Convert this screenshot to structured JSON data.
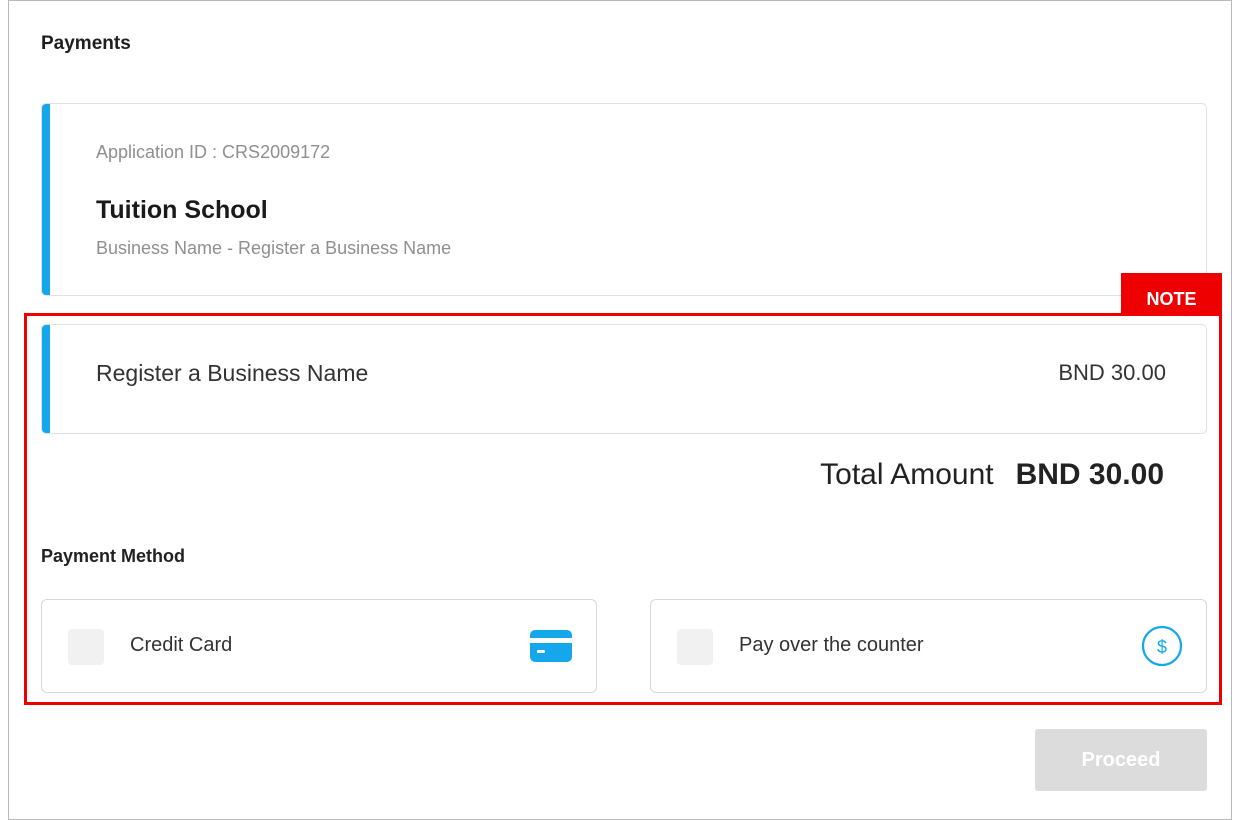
{
  "page": {
    "title": "Payments"
  },
  "application": {
    "id_text": "Application ID : CRS2009172",
    "name": "Tuition School",
    "description": "Business Name - Register a Business Name"
  },
  "note": {
    "tag": "NOTE",
    "color": "#ef0000"
  },
  "fee": {
    "label": "Register a Business Name",
    "amount": "BND 30.00"
  },
  "total": {
    "label": "Total Amount",
    "value": "BND 30.00"
  },
  "payment_method": {
    "heading": "Payment Method",
    "options": [
      {
        "label": "Credit Card",
        "icon": "credit-card-icon",
        "checked": false
      },
      {
        "label": "Pay over the counter",
        "icon": "dollar-circle-icon",
        "checked": false
      }
    ]
  },
  "actions": {
    "proceed_label": "Proceed",
    "proceed_enabled": false
  },
  "colors": {
    "accent": "#14a7ec",
    "note": "#ef0000",
    "button_disabled": "#dcdcdc"
  }
}
